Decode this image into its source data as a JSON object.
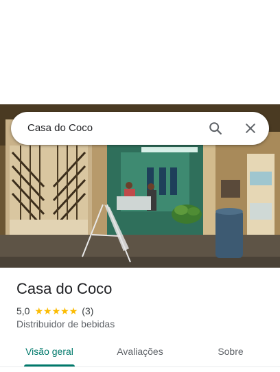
{
  "search": {
    "query": "Casa do Coco",
    "search_icon": "search-icon",
    "close_icon": "close-icon"
  },
  "place": {
    "name": "Casa do Coco",
    "rating": "5,0",
    "rating_value": 5,
    "review_count": "(3)",
    "category": "Distribuidor de bebidas",
    "star_color": "#fbbc04"
  },
  "tabs": [
    {
      "label": "Visão geral",
      "active": true
    },
    {
      "label": "Avaliações",
      "active": false
    },
    {
      "label": "Sobre",
      "active": false
    }
  ],
  "colors": {
    "accent": "#00796b"
  }
}
